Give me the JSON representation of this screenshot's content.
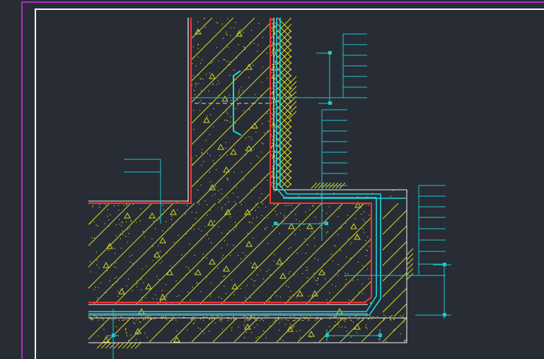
{
  "drawing": {
    "colors": {
      "background": "#272c35",
      "border_magenta": "#b12bc2",
      "frame_white": "#f4f4f4",
      "hatch_yellow": "#d9d52a",
      "waterproof_cyan": "#19d8df",
      "membrane_red": "#ff3030",
      "leader_cyan": "#1bc7cf"
    },
    "icons": [
      "concrete-hatch",
      "insulation-crosshatch",
      "earth-hatch",
      "dimension-node"
    ]
  }
}
